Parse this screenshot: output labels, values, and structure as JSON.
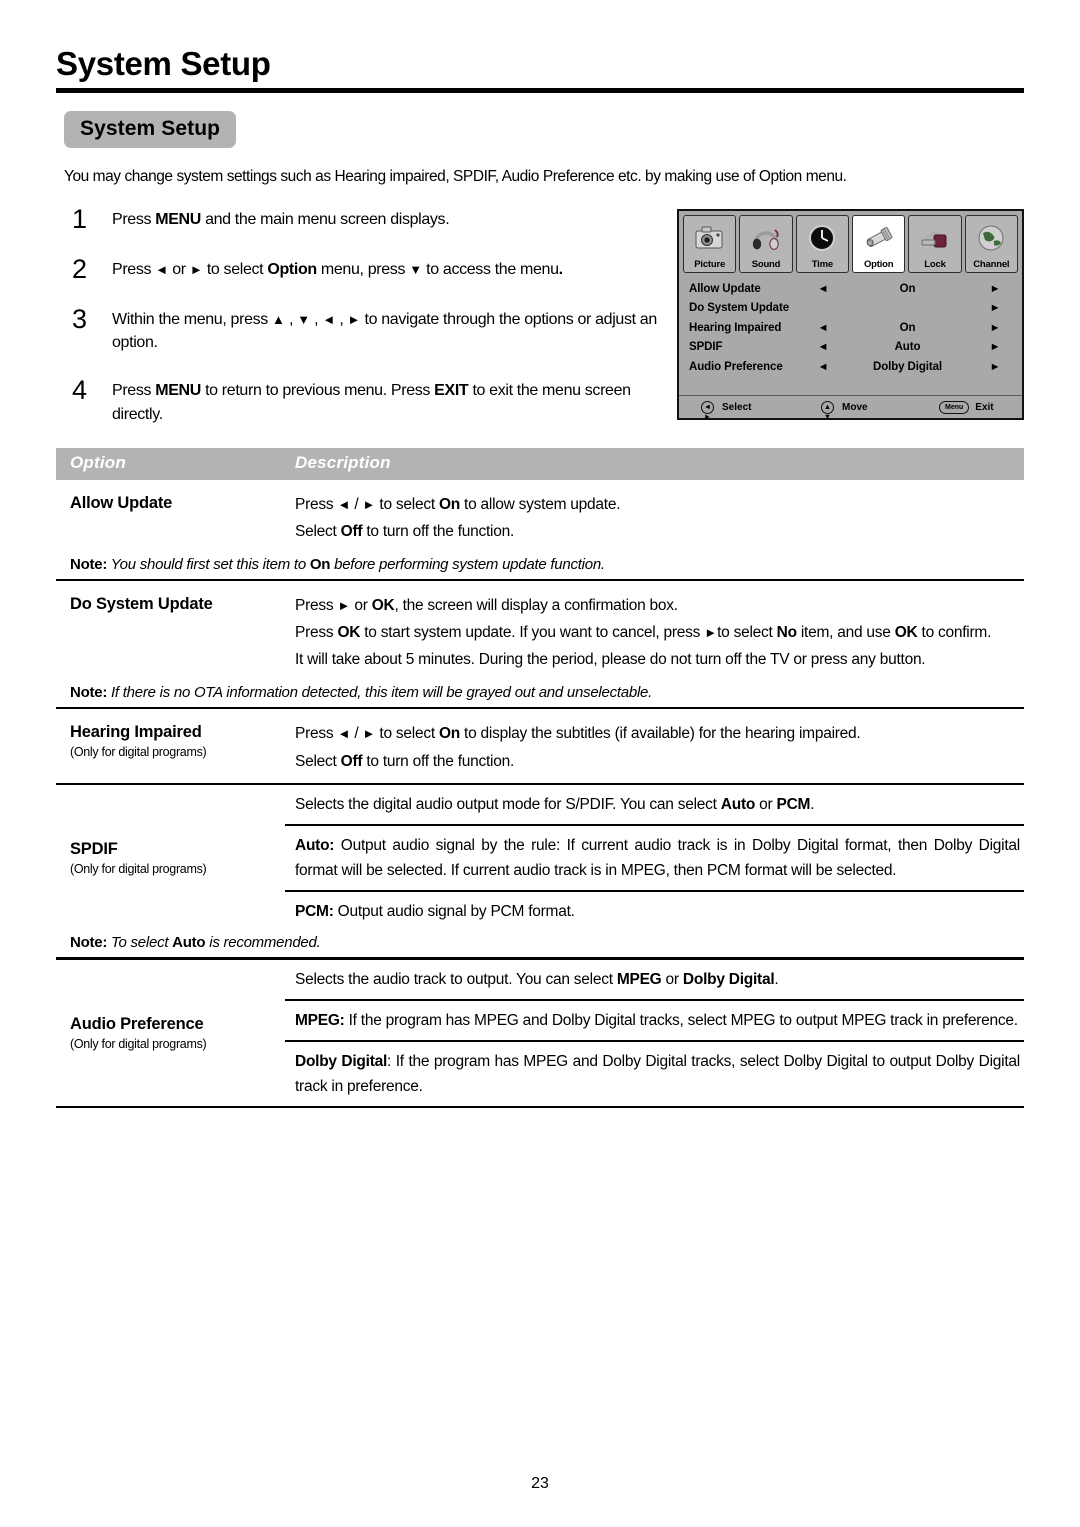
{
  "header": {
    "title": "System Setup",
    "chip": "System Setup",
    "intro": "You may change system settings such as Hearing impaired, SPDIF, Audio Preference etc. by making use of Option menu."
  },
  "steps": [
    {
      "num": "1",
      "text_html": "Press <b>MENU</b> and the main menu screen displays."
    },
    {
      "num": "2",
      "text_html": "Press <span class=\"ar\">&#9668;</span> or <span class=\"ar\">&#9658;</span> to select <b>Option</b> menu,  press <span class=\"ar\">&#9660;</span> to access the menu<b>.</b>"
    },
    {
      "num": "3",
      "text_html": "Within the menu, press <span class=\"ar\">&#9650;</span> , <span class=\"ar\">&#9660;</span> , <span class=\"ar\">&#9668;</span> , <span class=\"ar\">&#9658;</span>  to navigate through the options or adjust an option."
    },
    {
      "num": "4",
      "text_html": "Press <b>MENU</b> to return to previous menu. Press <b>EXIT</b> to exit the menu screen directly."
    }
  ],
  "osd": {
    "tabs": [
      {
        "label": "Picture",
        "icon": "camera-icon",
        "active": false
      },
      {
        "label": "Sound",
        "icon": "headphones-icon",
        "active": false
      },
      {
        "label": "Time",
        "icon": "clock-icon",
        "active": false
      },
      {
        "label": "Option",
        "icon": "tools-icon",
        "active": true
      },
      {
        "label": "Lock",
        "icon": "padlock-icon",
        "active": false
      },
      {
        "label": "Channel",
        "icon": "globe-icon",
        "active": false
      }
    ],
    "rows": [
      {
        "label": "Allow Update",
        "left": "◄",
        "value": "On",
        "right": "►"
      },
      {
        "label": "Do System Update",
        "left": "",
        "value": "",
        "right": "►"
      },
      {
        "label": "Hearing Impaired",
        "left": "◄",
        "value": "On",
        "right": "►"
      },
      {
        "label": "SPDIF",
        "left": "◄",
        "value": "Auto",
        "right": "►"
      },
      {
        "label": "Audio Preference",
        "left": "◄",
        "value": "Dolby Digital",
        "right": "►"
      }
    ],
    "footer": {
      "select_keys": "◄ ►",
      "select_label": "Select",
      "move_keys": "▲ ▼",
      "move_label": "Move",
      "exit_key": "Menu",
      "exit_label": "Exit"
    },
    "colors": {
      "panel_bg": "#a9a9a9",
      "tab_bg": "#b6b6b6",
      "tab_active_bg": "#ffffff"
    }
  },
  "table": {
    "head": {
      "option": "Option",
      "description": "Description"
    },
    "rows": [
      {
        "name": "Allow Update",
        "sub": "",
        "paragraphs": [
          "Press <span class=\"ar\">&#9668;</span> / <span class=\"ar\">&#9658;</span>  to select <b>On</b> to allow system update.",
          "Select <b>Off</b> to turn off the function."
        ],
        "note": "<b>Note:</b> <i>You should first set this item to </i><b>On</b><i> before performing system update function.</i>"
      },
      {
        "name": "Do System Update",
        "sub": "",
        "paragraphs": [
          "Press <span class=\"ar\">&#9658;</span> or <b>OK</b>, the screen will display a confirmation box.",
          "Press <b>OK</b> to start system update. If you want to cancel, press <span class=\"ar\">&#9658;</span>to select <b>No</b> item, and use <b>OK</b>  to confirm.",
          "It will take about 5 minutes. During the period, please do not turn off the TV or press any button."
        ],
        "note": "<b>Note:</b> <i>If there is no OTA information detected, this item will be grayed out and unselectable.</i>"
      },
      {
        "name": "Hearing Impaired",
        "sub": "(Only for digital programs)",
        "paragraphs": [
          "Press <span class=\"ar\">&#9668;</span> / <span class=\"ar\">&#9658;</span>  to select <b>On</b> to display the subtitles (if available) for the hearing impaired.",
          "Select <b>Off</b> to turn off the function."
        ],
        "note": ""
      },
      {
        "name": "SPDIF",
        "sub": "(Only for digital programs)",
        "sub_paragraphs": [
          "Selects the digital audio output mode for S/PDIF. You can select <b>Auto</b> or <b>PCM</b>.",
          "<b>Auto:</b> Output audio signal by the rule: If current audio track is in Dolby Digital format, then Dolby Digital format will be selected. If current audio track is in MPEG, then PCM format will be selected.",
          "<b>PCM:</b> Output audio signal by PCM format."
        ],
        "note": "<b>Note:</b> <i>To select </i><b>Auto</b><i> is recommended.</i>"
      },
      {
        "name": "Audio Preference",
        "sub": "(Only for digital programs)",
        "sub_paragraphs": [
          "Selects the audio track to output. You can select <b>MPEG</b> or <b>Dolby Digital</b>.",
          "<b>MPEG:</b> If the program has MPEG and Dolby Digital tracks, select MPEG to output MPEG track in preference.",
          "<b>Dolby Digital</b>: If the program has MPEG and Dolby Digital tracks, select Dolby Digital to output Dolby Digital track in preference."
        ],
        "note": ""
      }
    ]
  },
  "footer": {
    "page_number": "23"
  }
}
